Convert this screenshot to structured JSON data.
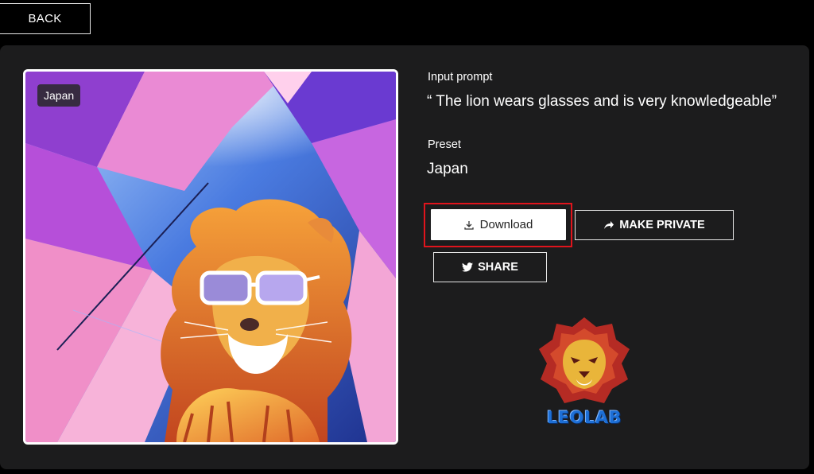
{
  "nav": {
    "back_label": "BACK"
  },
  "artwork": {
    "preset_tag": "Japan",
    "subject": "lion-with-glasses"
  },
  "details": {
    "prompt_label": "Input prompt",
    "prompt_text": "“ The lion wears glasses and is very knowledgeable”",
    "preset_label": "Preset",
    "preset_value": "Japan"
  },
  "actions": {
    "download_label": "Download",
    "make_private_label": "MAKE PRIVATE",
    "share_label": "SHARE"
  },
  "logo": {
    "text": "LEOLAB"
  },
  "colors": {
    "background": "#000000",
    "panel": "#1c1c1d",
    "highlight": "#e0141c",
    "logo_blue": "#1d6fd6"
  }
}
